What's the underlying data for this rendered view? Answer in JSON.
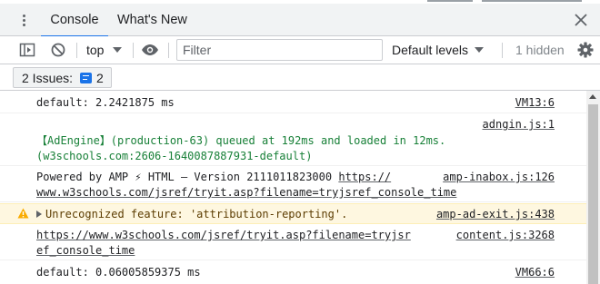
{
  "tabs": {
    "console": "Console",
    "whats_new": "What's New"
  },
  "toolbar": {
    "context": "top",
    "filter_placeholder": "Filter",
    "levels": "Default levels",
    "hidden": "1 hidden"
  },
  "issues": {
    "label": "2 Issues:",
    "count": "2"
  },
  "messages": [
    {
      "text": "default: 2.2421875 ms",
      "source": "VM13:6"
    },
    {
      "source": "adngin.js:1",
      "line1": "【AdEngine】(production-63) queued at 192ms and loaded in 12ms.",
      "line2": "(w3schools.com:2606-1640087887931-default)"
    },
    {
      "line1_text": "Powered by AMP ⚡ HTML – Version 2111011823000 ",
      "line1_link": "https://",
      "line2": "www.w3schools.com/jsref/tryit.asp?filename=tryjsref_console_time",
      "source": "amp-inabox.js:126"
    },
    {
      "text": "Unrecognized feature: 'attribution-reporting'.",
      "source": "amp-ad-exit.js:438",
      "level": "warning"
    },
    {
      "line1": "https://www.w3schools.com/jsref/tryit.asp?filename=tryjsr",
      "line2": "ef_console_time",
      "source": "content.js:3268"
    },
    {
      "text": "default: 0.06005859375 ms",
      "source": "VM66:6"
    }
  ],
  "colors": {
    "accent": "#1a73e8",
    "adengine_text": "#188038",
    "warning_bg": "#fef7e0",
    "warning_text": "#5c3c00",
    "warning_icon": "#f9ab00"
  },
  "icons": {
    "more": "more-vertical-icon",
    "close": "close-icon",
    "sidebar": "sidebar-toggle-icon",
    "clear": "clear-console-icon",
    "eye": "eye-icon",
    "settings": "gear-icon",
    "issue": "issue-chip-icon",
    "warning": "warning-triangle-icon"
  }
}
